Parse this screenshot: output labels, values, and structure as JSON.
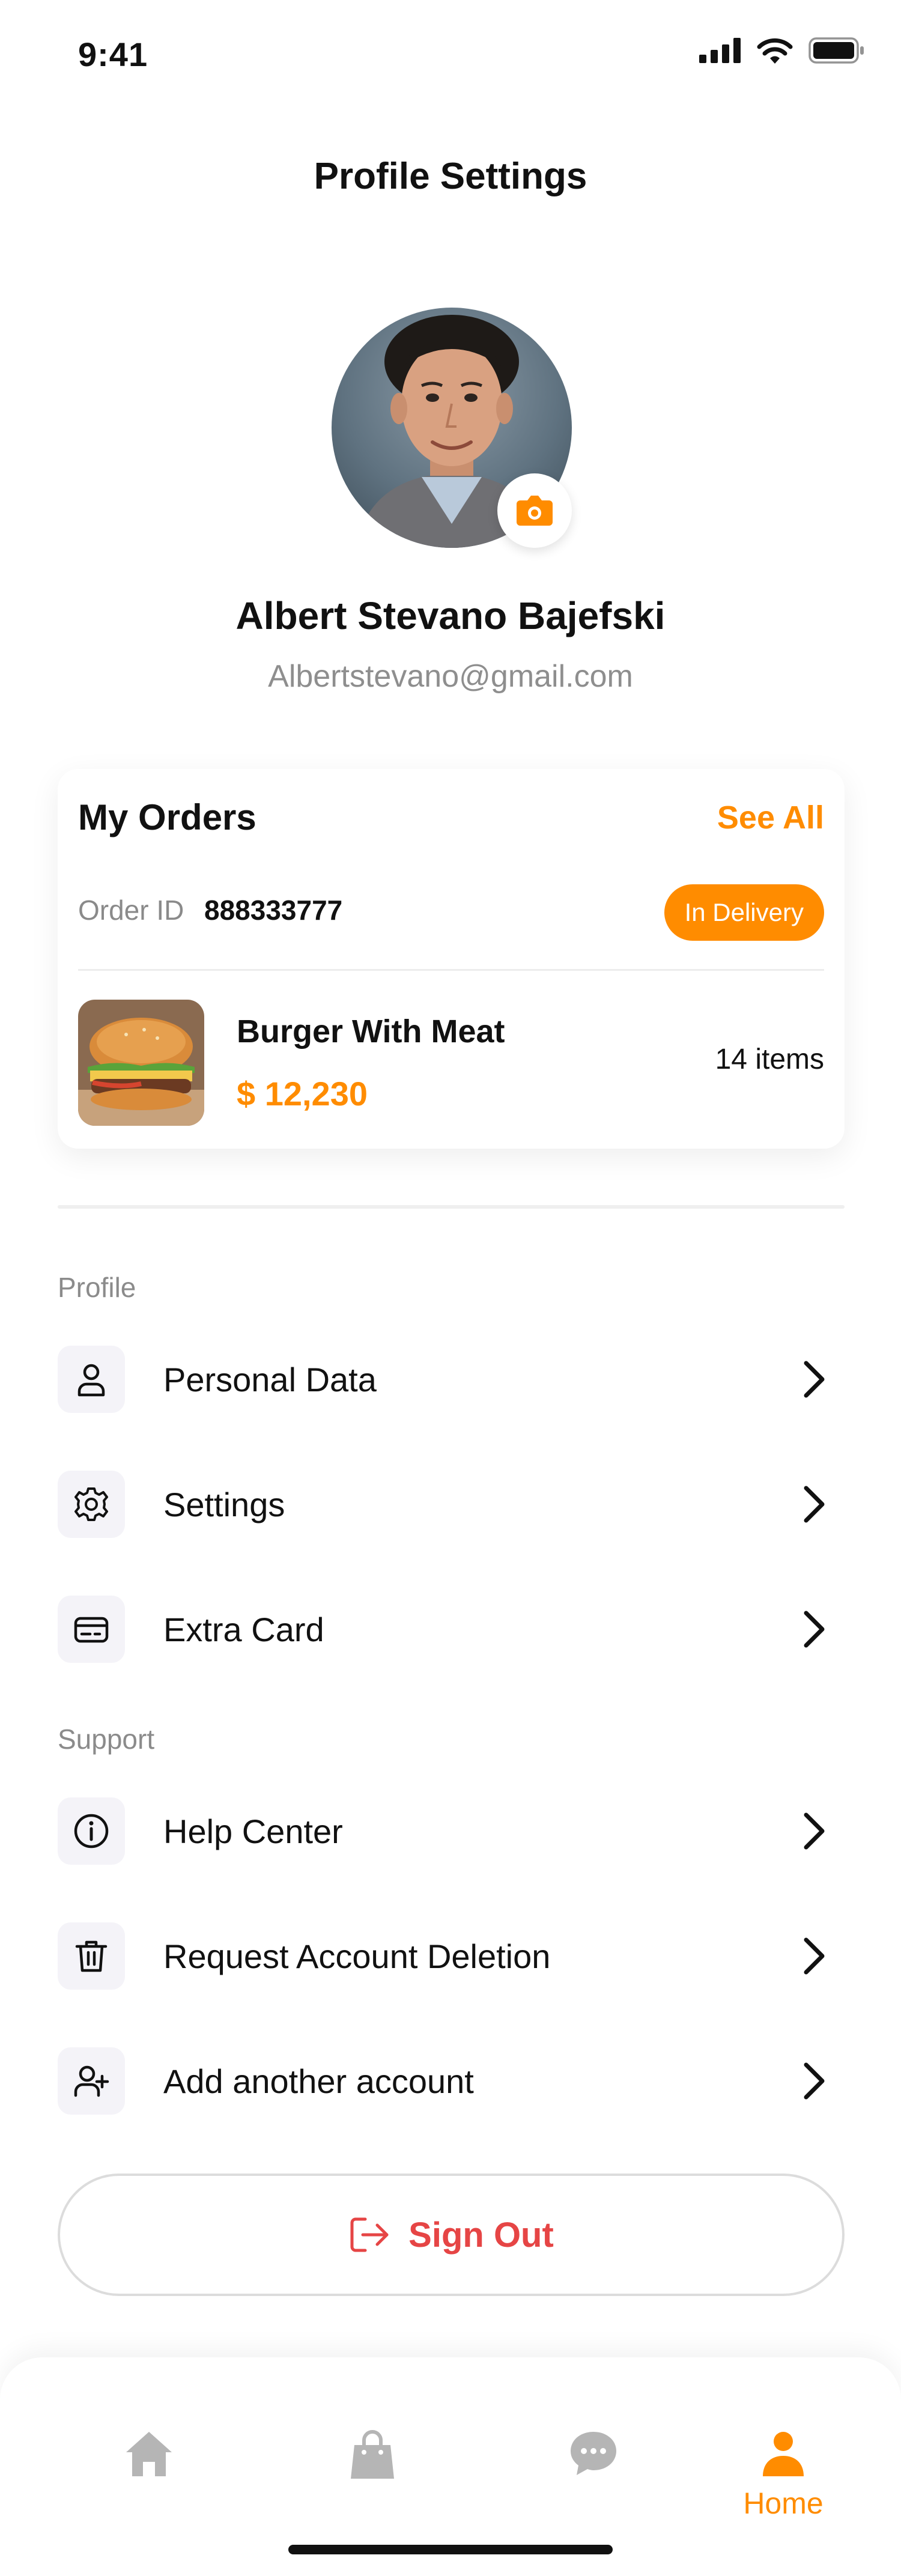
{
  "status_bar": {
    "time": "9:41"
  },
  "header": {
    "title": "Profile Settings"
  },
  "profile": {
    "name": "Albert Stevano Bajefski",
    "email": "Albertstevano@gmail.com"
  },
  "orders": {
    "title": "My Orders",
    "see_all": "See All",
    "order_id_label": "Order ID",
    "order_id_value": "888333777",
    "status": "In Delivery",
    "item": {
      "name": "Burger With Meat",
      "price": "$ 12,230",
      "count": "14 items"
    }
  },
  "sections": {
    "profile_label": "Profile",
    "support_label": "Support"
  },
  "menu": {
    "personal_data": "Personal Data",
    "settings": "Settings",
    "extra_card": "Extra Card",
    "help_center": "Help Center",
    "request_deletion": "Request Account Deletion",
    "add_account": "Add another account"
  },
  "sign_out": {
    "label": "Sign Out"
  },
  "bottom_nav": {
    "active_label": "Home",
    "items": [
      "home-icon",
      "bag-icon",
      "chat-icon",
      "profile-icon"
    ]
  },
  "colors": {
    "accent": "#ff8c00",
    "danger": "#e64545",
    "muted": "#8e8e8e",
    "icon_bg": "#f4f3f8"
  }
}
